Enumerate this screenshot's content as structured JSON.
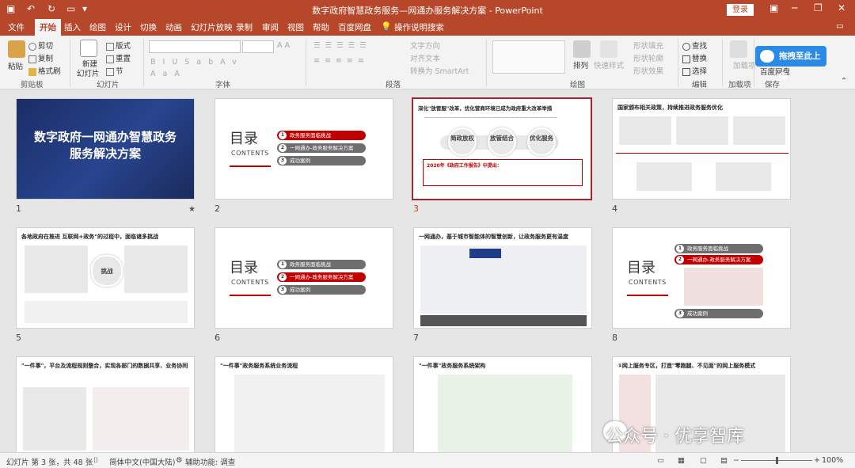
{
  "title_bar": {
    "title": "数字政府智慧政务服务—网通办服务解决方案  -  PowerPoint",
    "login": "登录"
  },
  "tabs": [
    "文件",
    "开始",
    "插入",
    "绘图",
    "设计",
    "切换",
    "动画",
    "幻灯片放映",
    "录制",
    "审阅",
    "视图",
    "帮助",
    "百度网盘",
    "操作说明搜索"
  ],
  "active_tab": "开始",
  "ribbon": {
    "clipboard": {
      "paste": "粘贴",
      "cut": "剪切",
      "copy": "复制",
      "format_painter": "格式刷",
      "group": "剪贴板"
    },
    "slides": {
      "new_slide_1": "新建",
      "new_slide_2": "幻灯片",
      "layout": "版式",
      "reset": "重置",
      "section": "节",
      "group": "幻灯片"
    },
    "font": {
      "group": "字体"
    },
    "paragraph": {
      "text_direction": "文字方向",
      "align_text": "对齐文本",
      "smartart": "转换为 SmartArt",
      "group": "段落"
    },
    "drawing": {
      "arrange": "排列",
      "quick_styles": "快速样式",
      "fill": "形状填充",
      "outline": "形状轮廓",
      "effects": "形状效果",
      "group": "绘图"
    },
    "editing": {
      "find": "查找",
      "replace": "替换",
      "select": "选择",
      "group": "编辑"
    },
    "addins": {
      "addins": "加载项",
      "group": "加载项"
    },
    "save": {
      "baidu": "百度网盘",
      "group": "保存"
    },
    "plugin_button": "拖拽至此上传"
  },
  "slides": [
    {
      "num": "1",
      "title": "数字政府一网通办智慧政务服务解决方案",
      "star": "★"
    },
    {
      "num": "2",
      "toc_title": "目录",
      "toc_sub": "CONTENTS",
      "items": [
        "政务服务面临挑战",
        "一网通办-政务服务解决方案",
        "成功案例"
      ],
      "active": 1
    },
    {
      "num": "3",
      "title": "深化\"放管服\"改革，优化营商环境已成为政府重大改革举措",
      "circles": [
        "简政放权",
        "放管结合",
        "优化服务"
      ],
      "note": "2020年《政府工作报告》中提出："
    },
    {
      "num": "4",
      "title": "国家颁布相关政策，持续推进政务服务优化"
    },
    {
      "num": "5",
      "title": "各地政府在推进 互联网+政务\"的过程中，面临诸多挑战",
      "center": "挑战"
    },
    {
      "num": "6",
      "toc_title": "目录",
      "toc_sub": "CONTENTS",
      "items": [
        "政务服务面临挑战",
        "一网通办-政务服务解决方案",
        "成功案例"
      ],
      "active": 2
    },
    {
      "num": "7",
      "title": "一网通办，基于城市智能体的智慧创新，让政务服务更有温度"
    },
    {
      "num": "8",
      "toc_title": "目录",
      "toc_sub": "CONTENTS",
      "items": [
        "政务服务面临挑战",
        "一网通办-政务服务解决方案",
        "成功案例"
      ],
      "active": 2
    },
    {
      "num": "9",
      "title": "\"一件事\"，平台及流程规则整合，实现各部门的数据共享、业务协同"
    },
    {
      "num": "10",
      "title": "\"一件事\"政务服务系统业务流程"
    },
    {
      "num": "11",
      "title": "\"一件事\"政务服务系统架构"
    },
    {
      "num": "12",
      "title": "①网上服务专区，打造\"零跑腿、不见面\"的网上服务模式"
    }
  ],
  "watermark": "公众号 · 优享智库",
  "status": {
    "slide_info": "幻灯片 第 3 张，共 48 张",
    "language": "简体中文(中国大陆)",
    "accessibility": "辅助功能: 调查",
    "zoom": "100%"
  }
}
